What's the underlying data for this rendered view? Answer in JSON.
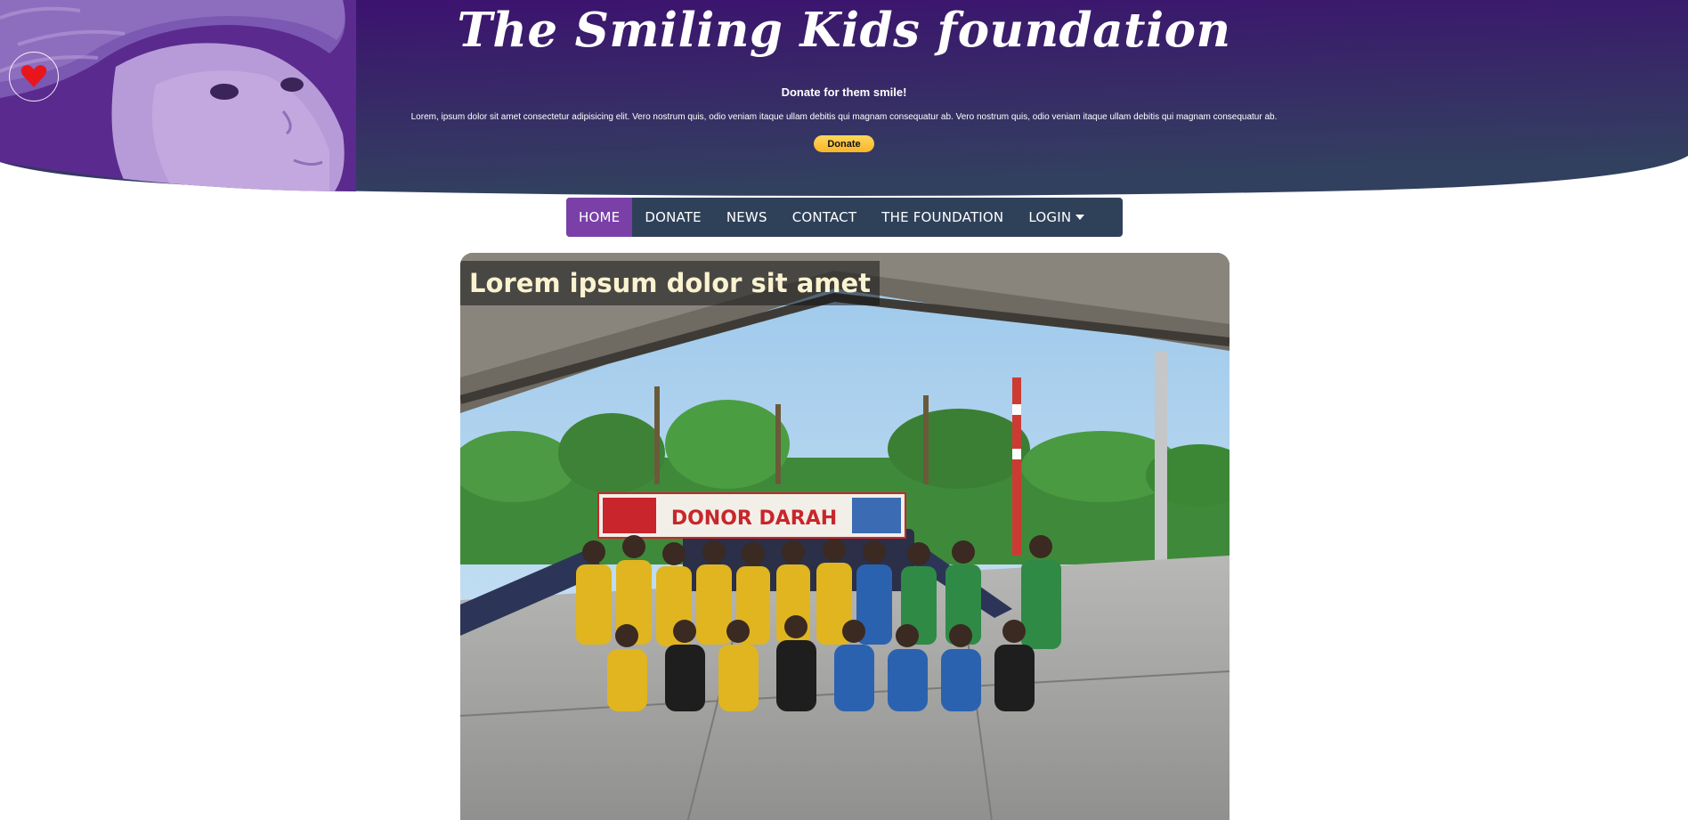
{
  "header": {
    "title": "The Smiling Kids foundation",
    "tagline": "Donate for them smile!",
    "lede": "Lorem, ipsum dolor sit amet consectetur adipisicing elit. Vero nostrum quis, odio veniam itaque ullam debitis qui magnam consequatur ab. Vero nostrum quis, odio veniam itaque ullam debitis qui magnam consequatur ab.",
    "donate_label": "Donate"
  },
  "nav": {
    "items": [
      {
        "label": "HOME",
        "active": true
      },
      {
        "label": "DONATE"
      },
      {
        "label": "NEWS"
      },
      {
        "label": "CONTACT"
      },
      {
        "label": "THE FOUNDATION"
      },
      {
        "label": "LOGIN"
      }
    ]
  },
  "feature": {
    "title": "Lorem ipsum dolor sit amet",
    "banner_text": "DONOR DARAH"
  },
  "colors": {
    "header_top": "#3d1070",
    "header_bottom": "#32405f",
    "nav_bg": "#2f4159",
    "nav_active": "#7a40a8",
    "heart": "#e8161c",
    "donate_button": "#f9b52a"
  }
}
